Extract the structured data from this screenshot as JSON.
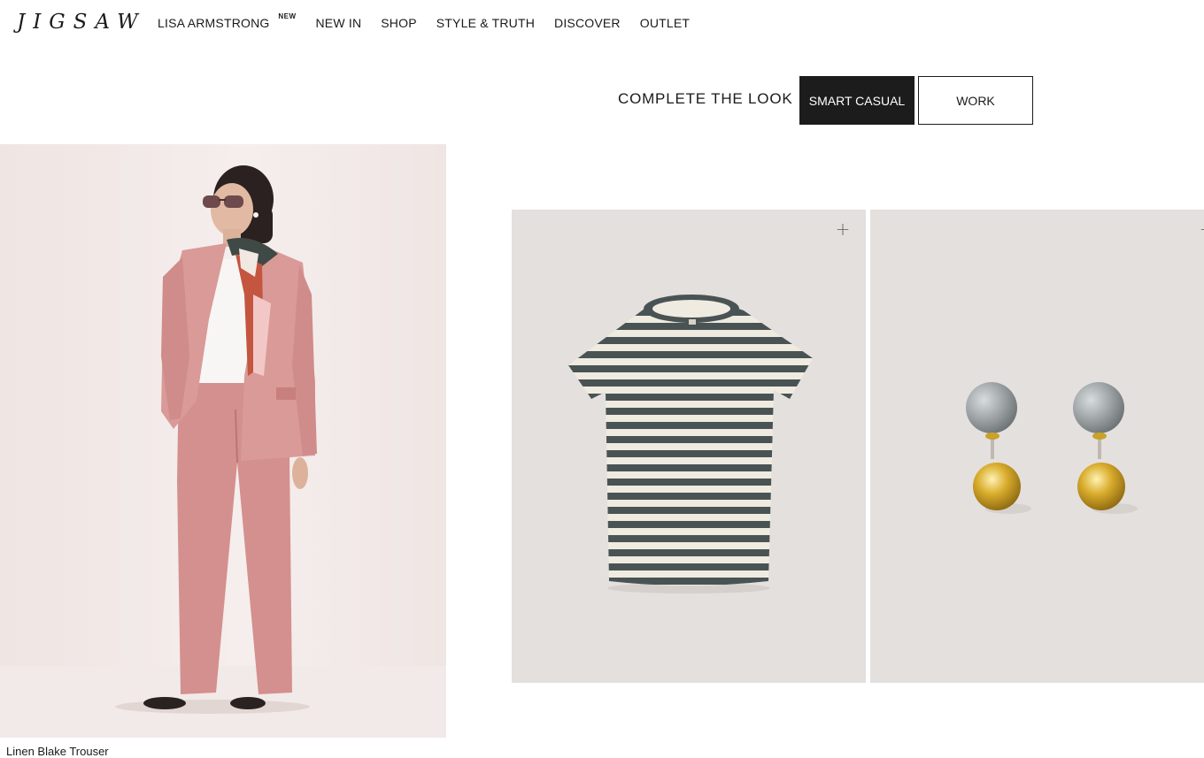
{
  "header": {
    "logo": "JIGSAW",
    "nav": [
      {
        "label": "LISA ARMSTRONG",
        "badge": "NEW"
      },
      {
        "label": "NEW IN"
      },
      {
        "label": "SHOP"
      },
      {
        "label": "STYLE & TRUTH"
      },
      {
        "label": "DISCOVER"
      },
      {
        "label": "OUTLET"
      }
    ]
  },
  "complete_the_look": {
    "label": "COMPLETE THE LOOK",
    "tabs": [
      {
        "label": "SMART CASUAL",
        "active": true
      },
      {
        "label": "WORK",
        "active": false
      }
    ]
  },
  "main_product": {
    "caption": "Linen Blake Trouser"
  },
  "products": [
    {
      "image": "striped-tshirt",
      "add_icon": "plus-icon"
    },
    {
      "image": "marble-gold-earrings",
      "add_icon": "plus-icon"
    }
  ],
  "colors": {
    "accent_dark": "#1c1c1c",
    "card_bg": "#e4e0de",
    "stripe_dark": "#4a5354",
    "stripe_light": "#efebe0",
    "suit_pink": "#d99a98",
    "gold": "#c9a227"
  }
}
